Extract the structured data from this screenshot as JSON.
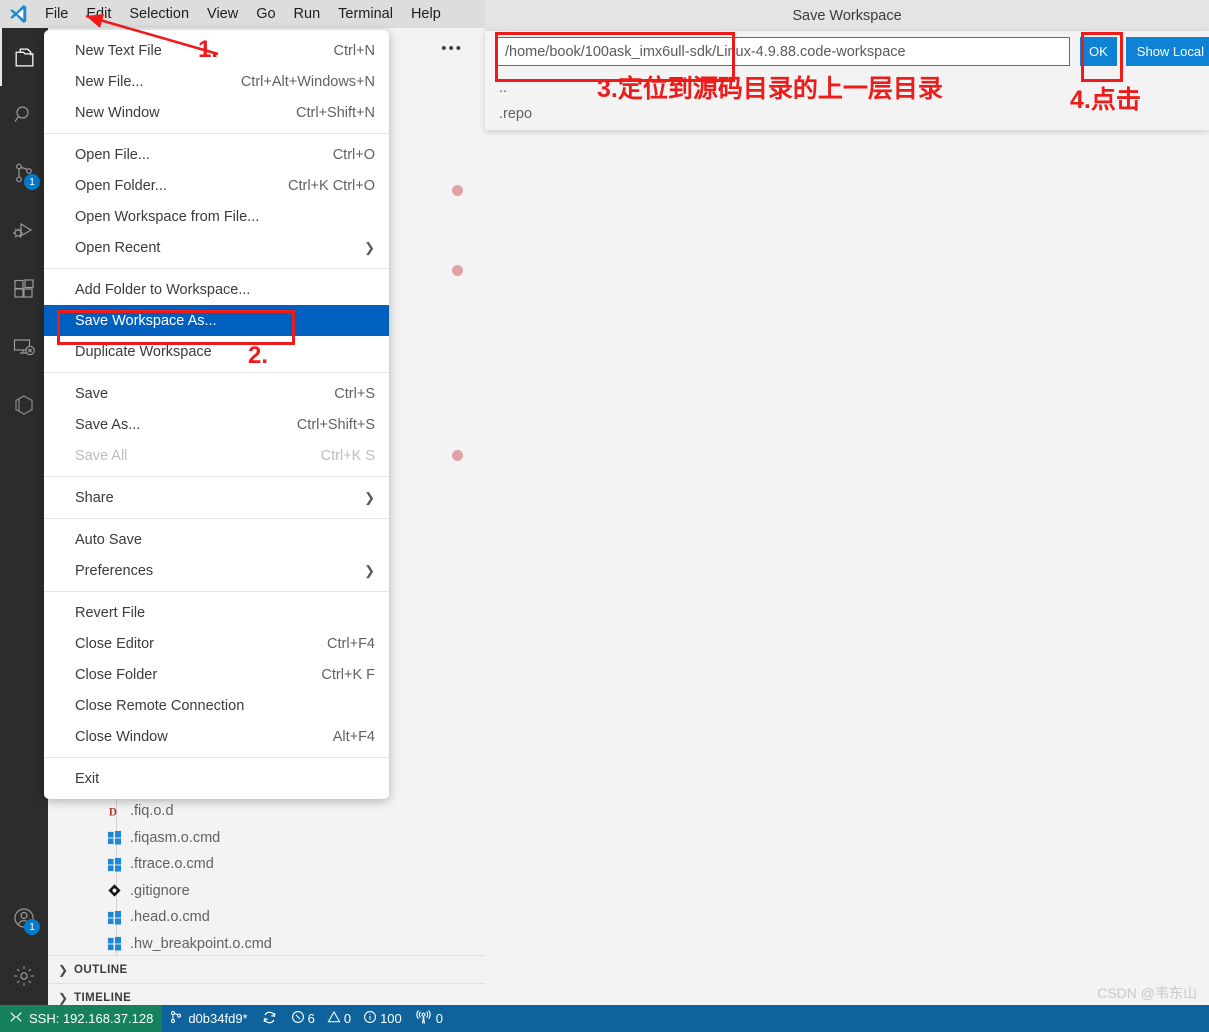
{
  "window": {
    "logo_icon": "vscode-logo-icon"
  },
  "menubar": {
    "items": [
      {
        "label": "File",
        "active": true
      },
      {
        "label": "Edit",
        "active": false
      },
      {
        "label": "Selection",
        "active": false
      },
      {
        "label": "View",
        "active": false
      },
      {
        "label": "Go",
        "active": false
      },
      {
        "label": "Run",
        "active": false
      },
      {
        "label": "Terminal",
        "active": false
      },
      {
        "label": "Help",
        "active": false
      }
    ]
  },
  "activitybar": {
    "items": [
      {
        "icon": "explorer-files-icon",
        "name": "explorer",
        "selected": true,
        "badge": ""
      },
      {
        "icon": "search-icon",
        "name": "search",
        "selected": false,
        "badge": ""
      },
      {
        "icon": "source-control-branch-icon",
        "name": "source-control",
        "selected": false,
        "badge": "1"
      },
      {
        "icon": "run-and-debug-icon",
        "name": "run-and-debug",
        "selected": false,
        "badge": ""
      },
      {
        "icon": "extensions-blocks-icon",
        "name": "extensions",
        "selected": false,
        "badge": ""
      },
      {
        "icon": "remote-explorer-screen-icon",
        "name": "remote-explorer",
        "selected": false,
        "badge": ""
      },
      {
        "icon": "container-box-icon",
        "name": "containers",
        "selected": false,
        "badge": ""
      }
    ],
    "bottom": [
      {
        "icon": "account-person-icon",
        "name": "accounts",
        "badge": "1"
      },
      {
        "icon": "gear-icon",
        "name": "manage-settings",
        "badge": ""
      }
    ]
  },
  "sidebar": {
    "more_actions_icon": "ellipsis-icon",
    "tree": [
      {
        "label": ".fiq.o.d",
        "icon": "d-file-icon"
      },
      {
        "label": ".fiqasm.o.cmd",
        "icon": "windows-file-icon"
      },
      {
        "label": ".ftrace.o.cmd",
        "icon": "windows-file-icon"
      },
      {
        "label": ".gitignore",
        "icon": "git-file-icon"
      },
      {
        "label": ".head.o.cmd",
        "icon": "windows-file-icon"
      },
      {
        "label": ".hw_breakpoint.o.cmd",
        "icon": "windows-file-icon"
      }
    ],
    "panels": [
      {
        "label": "OUTLINE",
        "expanded": false
      },
      {
        "label": "TIMELINE",
        "expanded": false
      }
    ]
  },
  "file_menu": {
    "groups": [
      [
        {
          "label": "New Text File",
          "keys": "Ctrl+N",
          "submenu": false,
          "disabled": false,
          "selected": false
        },
        {
          "label": "New File...",
          "keys": "Ctrl+Alt+Windows+N",
          "submenu": false,
          "disabled": false,
          "selected": false
        },
        {
          "label": "New Window",
          "keys": "Ctrl+Shift+N",
          "submenu": false,
          "disabled": false,
          "selected": false
        }
      ],
      [
        {
          "label": "Open File...",
          "keys": "Ctrl+O",
          "submenu": false,
          "disabled": false,
          "selected": false
        },
        {
          "label": "Open Folder...",
          "keys": "Ctrl+K Ctrl+O",
          "submenu": false,
          "disabled": false,
          "selected": false
        },
        {
          "label": "Open Workspace from File...",
          "keys": "",
          "submenu": false,
          "disabled": false,
          "selected": false
        },
        {
          "label": "Open Recent",
          "keys": "",
          "submenu": true,
          "disabled": false,
          "selected": false
        }
      ],
      [
        {
          "label": "Add Folder to Workspace...",
          "keys": "",
          "submenu": false,
          "disabled": false,
          "selected": false
        },
        {
          "label": "Save Workspace As...",
          "keys": "",
          "submenu": false,
          "disabled": false,
          "selected": true
        },
        {
          "label": "Duplicate Workspace",
          "keys": "",
          "submenu": false,
          "disabled": false,
          "selected": false
        }
      ],
      [
        {
          "label": "Save",
          "keys": "Ctrl+S",
          "submenu": false,
          "disabled": false,
          "selected": false
        },
        {
          "label": "Save As...",
          "keys": "Ctrl+Shift+S",
          "submenu": false,
          "disabled": false,
          "selected": false
        },
        {
          "label": "Save All",
          "keys": "Ctrl+K S",
          "submenu": false,
          "disabled": true,
          "selected": false
        }
      ],
      [
        {
          "label": "Share",
          "keys": "",
          "submenu": true,
          "disabled": false,
          "selected": false
        }
      ],
      [
        {
          "label": "Auto Save",
          "keys": "",
          "submenu": false,
          "disabled": false,
          "selected": false
        },
        {
          "label": "Preferences",
          "keys": "",
          "submenu": true,
          "disabled": false,
          "selected": false
        }
      ],
      [
        {
          "label": "Revert File",
          "keys": "",
          "submenu": false,
          "disabled": false,
          "selected": false
        },
        {
          "label": "Close Editor",
          "keys": "Ctrl+F4",
          "submenu": false,
          "disabled": false,
          "selected": false
        },
        {
          "label": "Close Folder",
          "keys": "Ctrl+K F",
          "submenu": false,
          "disabled": false,
          "selected": false
        },
        {
          "label": "Close Remote Connection",
          "keys": "",
          "submenu": false,
          "disabled": false,
          "selected": false
        },
        {
          "label": "Close Window",
          "keys": "Alt+F4",
          "submenu": false,
          "disabled": false,
          "selected": false
        }
      ],
      [
        {
          "label": "Exit",
          "keys": "",
          "submenu": false,
          "disabled": false,
          "selected": false
        }
      ]
    ]
  },
  "dialog": {
    "title": "Save Workspace",
    "path_value": "/home/book/100ask_imx6ull-sdk/Linux-4.9.88.code-workspace",
    "path_placeholder": "Save Workspace",
    "ok_label": "OK",
    "show_local_label": "Show Local",
    "list": [
      {
        "label": ".."
      },
      {
        "label": ".repo"
      }
    ]
  },
  "annotations": {
    "step1": "1.",
    "step2": "2.",
    "step3": "3.定位到源码目录的上一层目录",
    "step4": "4.点击",
    "color": "#ee1b1b"
  },
  "statusbar": {
    "remote_icon": "remote-ssh-icon",
    "remote_label": "SSH: 192.168.37.128",
    "branch_icon": "source-control-branch-icon",
    "branch_label": "d0b34fd9*",
    "sync_icon": "sync-refresh-icon",
    "error_icon": "error-circle-icon",
    "error_count": "6",
    "warning_icon": "warning-triangle-icon",
    "warning_count": "0",
    "info_icon": "info-circle-icon",
    "info_count": "100",
    "radio_icon": "radio-tower-icon",
    "radio_count": "0"
  },
  "watermark": {
    "text": "CSDN @韦东山"
  }
}
